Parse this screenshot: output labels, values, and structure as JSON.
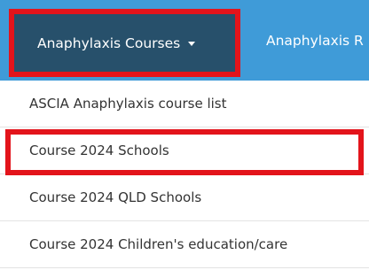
{
  "navbar": {
    "active_item": {
      "label": "Anaphylaxis Courses"
    },
    "second_item": {
      "label": "Anaphylaxis R"
    }
  },
  "dropdown": {
    "items": [
      {
        "label": "ASCIA Anaphylaxis course list"
      },
      {
        "label": "Course 2024 Schools"
      },
      {
        "label": "Course 2024 QLD Schools"
      },
      {
        "label": "Course 2024 Children's education/care"
      }
    ]
  },
  "colors": {
    "nav_background": "#3f9bd8",
    "active_background": "#27506b",
    "highlight_border": "#e3141b"
  }
}
